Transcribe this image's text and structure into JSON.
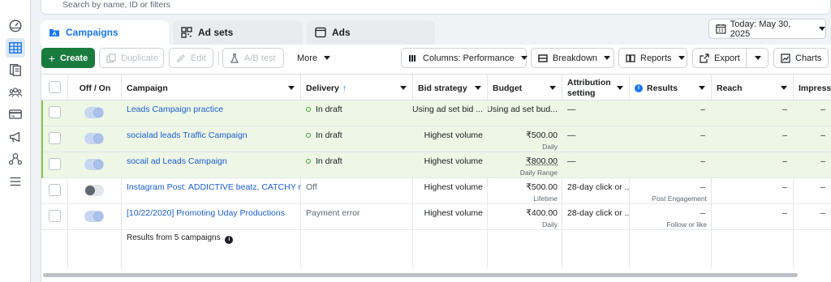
{
  "search": {
    "placeholder": "Search by name, ID or filters"
  },
  "rail": {
    "icons": [
      "dashboard-icon",
      "table-icon",
      "pages-icon",
      "audience-icon",
      "billing-icon",
      "megaphone-icon",
      "network-icon",
      "menu-icon"
    ]
  },
  "tabs": [
    {
      "label": "Campaigns",
      "active": true
    },
    {
      "label": "Ad sets",
      "active": false
    },
    {
      "label": "Ads",
      "active": false
    }
  ],
  "date_picker": {
    "label": "Today: May 30, 2025"
  },
  "toolbar": {
    "create": "Create",
    "duplicate": "Duplicate",
    "edit": "Edit",
    "ab_test": "A/B test",
    "more": "More",
    "columns": "Columns: Performance",
    "breakdown": "Breakdown",
    "reports": "Reports",
    "export": "Export",
    "charts": "Charts"
  },
  "table": {
    "headers": {
      "offon": "Off / On",
      "campaign": "Campaign",
      "delivery": "Delivery",
      "bid": "Bid strategy",
      "budget": "Budget",
      "attr_line1": "Attribution",
      "attr_line2": "setting",
      "results": "Results",
      "reach": "Reach",
      "impressions": "Impressio"
    },
    "rows": [
      {
        "campaign": "Leads Campaign practice",
        "delivery": "In draft",
        "bid": "Using ad set bid ...",
        "budget": "Using ad set bud...",
        "budget_sub": "",
        "attribution": "—",
        "results": "–",
        "results_sub": "",
        "reach": "–",
        "impressions": "–",
        "on": true
      },
      {
        "campaign": "socialad leads Traffic Campaign",
        "delivery": "In draft",
        "bid": "Highest volume",
        "budget": "₹500.00",
        "budget_sub": "Daily",
        "attribution": "—",
        "results": "–",
        "results_sub": "",
        "reach": "–",
        "impressions": "–",
        "on": true
      },
      {
        "campaign": "socail ad Leads Campaign",
        "delivery": "In draft",
        "bid": "Highest volume",
        "budget": "₹800.00",
        "budget_sub": "Daily Range",
        "attribution": "—",
        "results": "–",
        "results_sub": "",
        "reach": "–",
        "impressions": "–",
        "on": true
      },
      {
        "campaign": "Instagram Post: ADDICTIVE beatz, CATCHY ra...",
        "delivery": "Off",
        "bid": "Highest volume",
        "budget": "₹500.00",
        "budget_sub": "Lifetime",
        "attribution": "28-day click or ...",
        "results": "–",
        "results_sub": "Post Engagement",
        "reach": "–",
        "impressions": "–",
        "on": false
      },
      {
        "campaign": "[10/22/2020] Promoting Uday Productions",
        "delivery": "Payment error",
        "bid": "Highest volume",
        "budget": "₹400.00",
        "budget_sub": "Daily",
        "attribution": "28-day click or ...",
        "results": "–",
        "results_sub": "Follow or like",
        "reach": "–",
        "impressions": "–",
        "on": true
      }
    ],
    "footer": "Results from 5 campaigns"
  }
}
